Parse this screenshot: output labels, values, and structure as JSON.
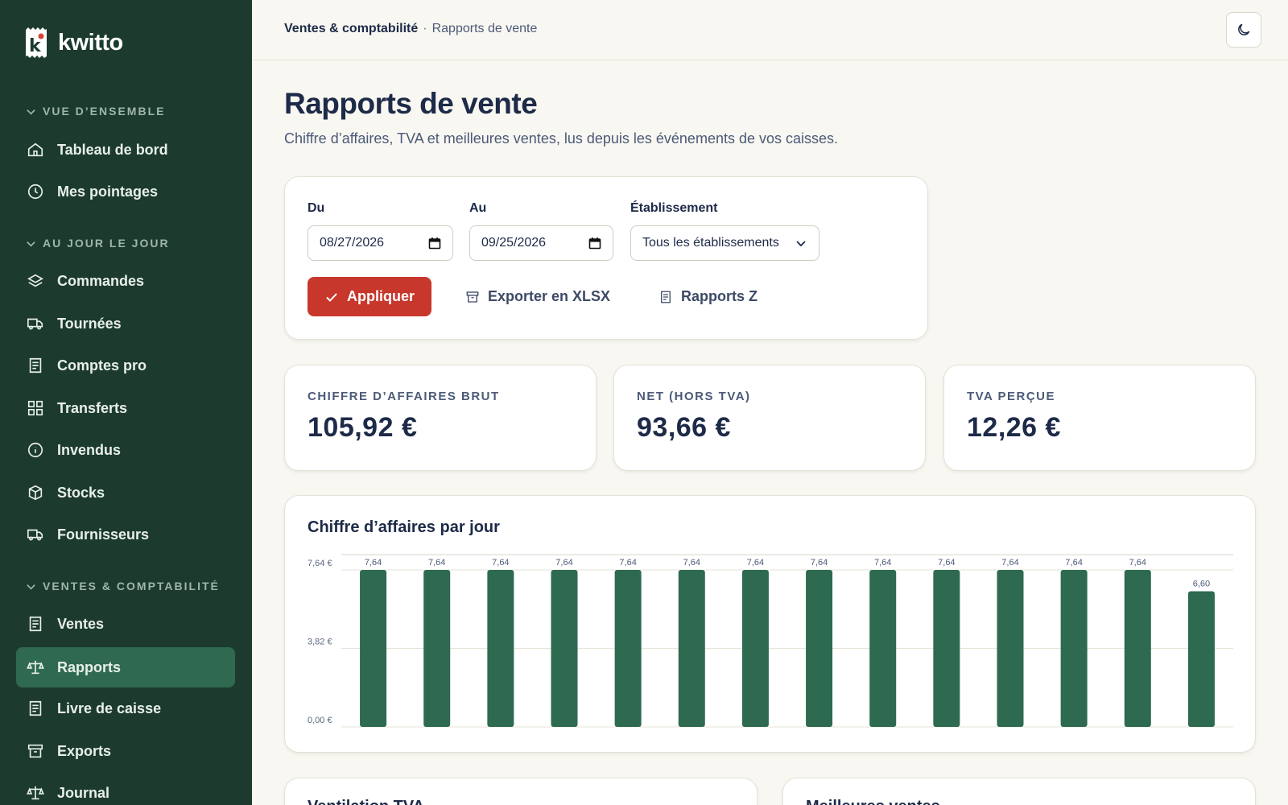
{
  "brand": {
    "name": "kwitto"
  },
  "sidebar": {
    "sections": [
      {
        "label": "VUE D’ENSEMBLE",
        "items": [
          {
            "label": "Tableau de bord",
            "icon": "home-icon"
          },
          {
            "label": "Mes pointages",
            "icon": "clock-icon"
          }
        ]
      },
      {
        "label": "AU JOUR LE JOUR",
        "items": [
          {
            "label": "Commandes",
            "icon": "layers-icon"
          },
          {
            "label": "Tournées",
            "icon": "truck-icon"
          },
          {
            "label": "Comptes pro",
            "icon": "receipt-icon"
          },
          {
            "label": "Transferts",
            "icon": "grid-icon"
          },
          {
            "label": "Invendus",
            "icon": "info-icon"
          },
          {
            "label": "Stocks",
            "icon": "box-icon"
          },
          {
            "label": "Fournisseurs",
            "icon": "truck-icon"
          }
        ]
      },
      {
        "label": "VENTES & COMPTABILITÉ",
        "items": [
          {
            "label": "Ventes",
            "icon": "receipt-icon"
          },
          {
            "label": "Rapports",
            "icon": "scale-icon",
            "active": true
          },
          {
            "label": "Livre de caisse",
            "icon": "receipt-icon"
          },
          {
            "label": "Exports",
            "icon": "archive-icon"
          },
          {
            "label": "Journal",
            "icon": "scale-icon"
          }
        ]
      }
    ]
  },
  "topbar": {
    "breadcrumb_parent": "Ventes & comptabilité",
    "breadcrumb_sep": "·",
    "breadcrumb_current": "Rapports de vente",
    "theme_icon": "moon-icon"
  },
  "page": {
    "title": "Rapports de vente",
    "subtitle": "Chiffre d’affaires, TVA et meilleures ventes, lus depuis les événements de vos caisses."
  },
  "filters": {
    "from_label": "Du",
    "from_value": "08/27/2026",
    "to_label": "Au",
    "to_value": "09/25/2026",
    "store_label": "Établissement",
    "store_value": "Tous les établissements",
    "apply_label": "Appliquer",
    "export_label": "Exporter en XLSX",
    "zreports_label": "Rapports Z"
  },
  "kpis": [
    {
      "label": "CHIFFRE D’AFFAIRES BRUT",
      "value": "105,92 €"
    },
    {
      "label": "NET (HORS TVA)",
      "value": "93,66 €"
    },
    {
      "label": "TVA PERÇUE",
      "value": "12,26 €"
    }
  ],
  "chart_title": "Chiffre d’affaires par jour",
  "chart_data": {
    "type": "bar",
    "title": "Chiffre d’affaires par jour",
    "values": [
      7.64,
      7.64,
      7.64,
      7.64,
      7.64,
      7.64,
      7.64,
      7.64,
      7.64,
      7.64,
      7.64,
      7.64,
      7.64,
      6.6
    ],
    "value_labels": [
      "7,64",
      "7,64",
      "7,64",
      "7,64",
      "7,64",
      "7,64",
      "7,64",
      "7,64",
      "7,64",
      "7,64",
      "7,64",
      "7,64",
      "7,64",
      "6,60"
    ],
    "yticks": [
      0,
      3.82,
      7.64
    ],
    "ytick_labels": [
      "0,00 €",
      "3,82 €",
      "7,64 €"
    ],
    "ylim": [
      0,
      7.64
    ],
    "grid": true,
    "bar_color": "#2d6a50"
  },
  "bottom_cards": [
    {
      "title": "Ventilation TVA"
    },
    {
      "title": "Meilleures ventes"
    }
  ]
}
